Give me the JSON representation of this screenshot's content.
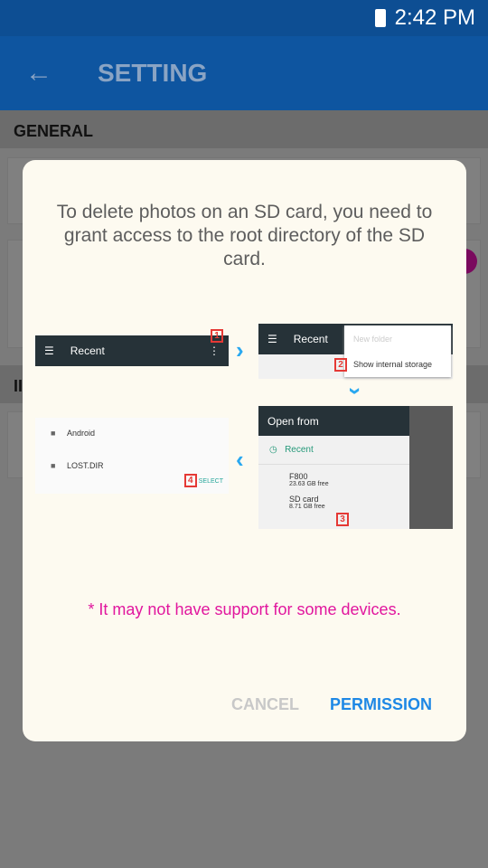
{
  "status_bar": {
    "time": "2:42 PM"
  },
  "app_bar": {
    "title": "SETTING"
  },
  "sections": {
    "general": "GENERAL",
    "second": "II"
  },
  "dialog": {
    "message": "To delete photos on an SD card, you need to grant access to the root directory of the SD card.",
    "steps": {
      "step1": {
        "title": "Recent",
        "badge": "1"
      },
      "step2": {
        "title": "Recent",
        "menu_item1": "New folder",
        "menu_item2": "Show internal storage",
        "badge": "2"
      },
      "step3": {
        "title": "Open from",
        "recent": "Recent",
        "device_name": "F800",
        "device_free": "23.63 GB free",
        "sd_name": "SD card",
        "sd_free": "8.71 GB free",
        "badge": "3"
      },
      "step4": {
        "folder1": "Android",
        "folder2": "LOST.DIR",
        "select": "SELECT",
        "badge": "4"
      }
    },
    "note": "* It may not have support for some devices.",
    "cancel": "CANCEL",
    "permission": "PERMISSION"
  },
  "colors": {
    "accent": "#1e88e5",
    "note": "#e1179e",
    "appbar": "#0e55a0"
  }
}
